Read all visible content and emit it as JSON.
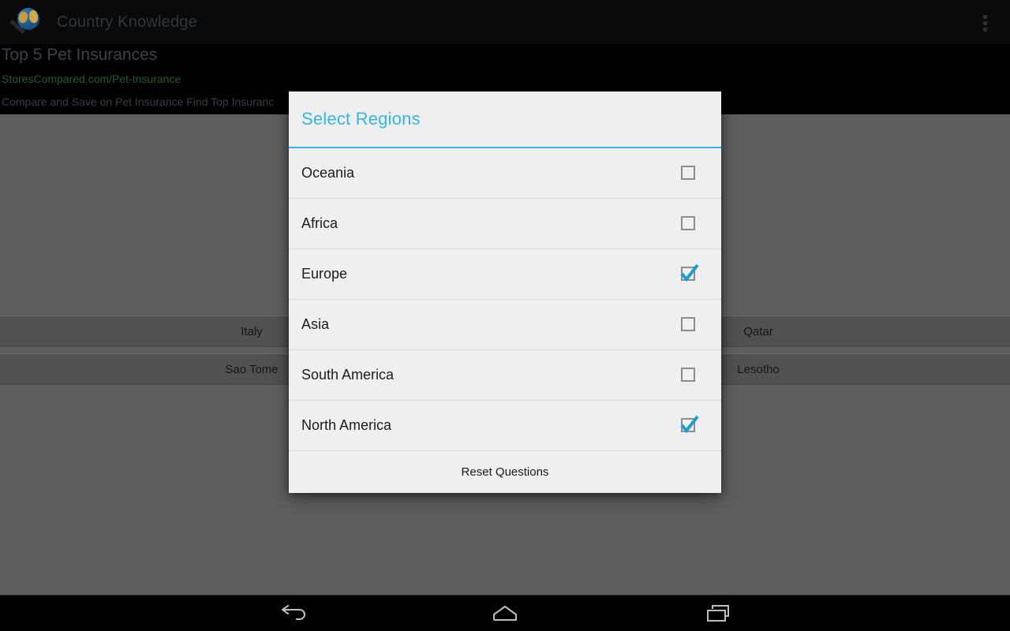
{
  "appbar": {
    "title": "Country Knowledge",
    "icon": "globe-icon",
    "overflow": "overflow-menu-icon"
  },
  "ad": {
    "headline": "Top 5 Pet Insurances",
    "url": "StoresCompared.com/Pet-Insurance",
    "description": "Compare and Save on Pet Insurance Find Top Insuranc",
    "arrow_icon": "chevron-right-icon"
  },
  "content": {
    "rows": [
      {
        "left": "Italy",
        "right": "Qatar"
      },
      {
        "left": "Sao Tome",
        "right": "Lesotho"
      }
    ]
  },
  "dialog": {
    "title": "Select Regions",
    "accent_color": "#33b5e5",
    "background_color": "#efeff0",
    "regions": [
      {
        "label": "Oceania",
        "checked": false
      },
      {
        "label": "Africa",
        "checked": false
      },
      {
        "label": "Europe",
        "checked": true
      },
      {
        "label": "Asia",
        "checked": false
      },
      {
        "label": "South America",
        "checked": false
      },
      {
        "label": "North America",
        "checked": true
      }
    ],
    "reset_label": "Reset Questions"
  },
  "navbar": {
    "back": "back-icon",
    "home": "home-icon",
    "recents": "recents-icon"
  }
}
